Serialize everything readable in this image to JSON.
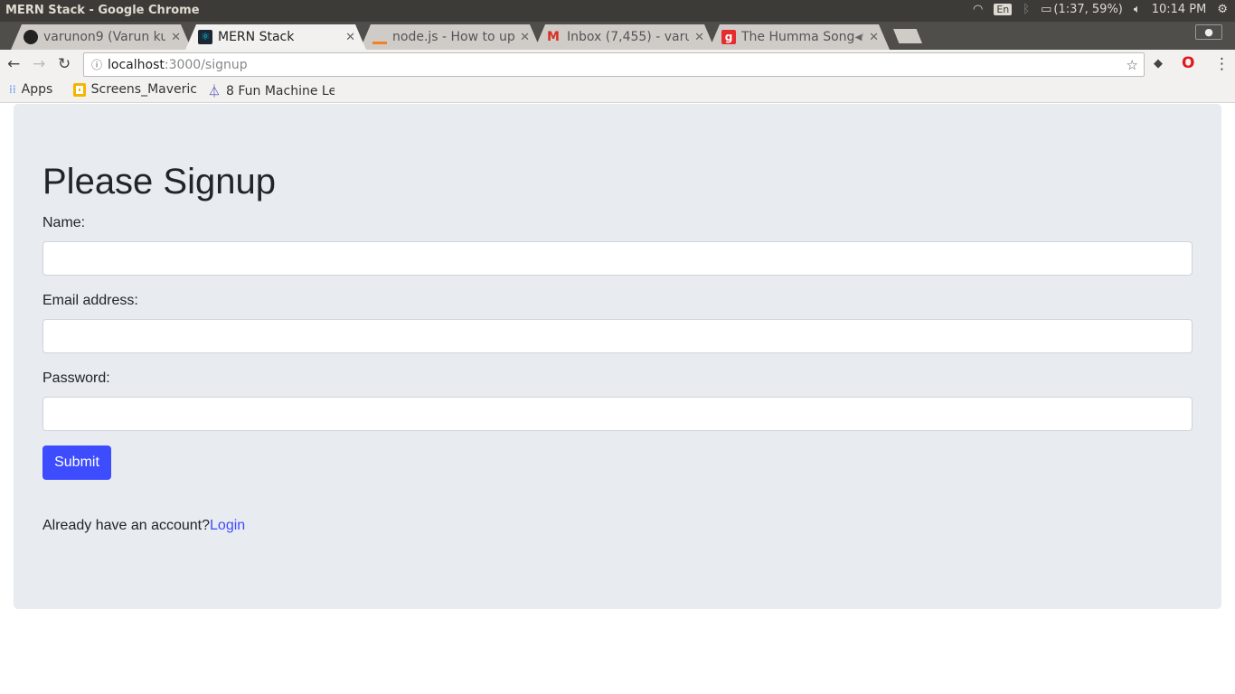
{
  "os": {
    "window_title": "MERN Stack - Google Chrome",
    "keyboard": "En",
    "battery": "(1:37, 59%)",
    "time": "10:14 PM"
  },
  "tabs": [
    {
      "label": "varunon9 (Varun ku",
      "icon": "github-icon",
      "color": "#222222"
    },
    {
      "label": "MERN Stack",
      "icon": "react-icon",
      "color": "#00d8ff",
      "active": true
    },
    {
      "label": "node.js - How to up",
      "icon": "stackoverflow-icon",
      "color": "#f48024"
    },
    {
      "label": "Inbox (7,455) - varu",
      "icon": "gmail-icon",
      "color": "#d93025"
    },
    {
      "label": "The Humma Song",
      "icon": "gaana-icon",
      "color": "#e72c30",
      "audio": true
    }
  ],
  "address": {
    "host": "localhost",
    "path": ":3000/signup"
  },
  "bookmarks": [
    {
      "label": "Apps",
      "icon": "apps-icon"
    },
    {
      "label": "Screens_Maveric",
      "icon": "slides-icon"
    },
    {
      "label": "8 Fun Machine Le",
      "icon": "flask-icon"
    }
  ],
  "page": {
    "title": "Please Signup",
    "fields": [
      {
        "label": "Name:",
        "value": ""
      },
      {
        "label": "Email address:",
        "value": ""
      },
      {
        "label": "Password:",
        "value": ""
      }
    ],
    "submit": "Submit",
    "already_text": "Already have an account?",
    "login_link": "Login",
    "accent": "#3d4cff"
  }
}
